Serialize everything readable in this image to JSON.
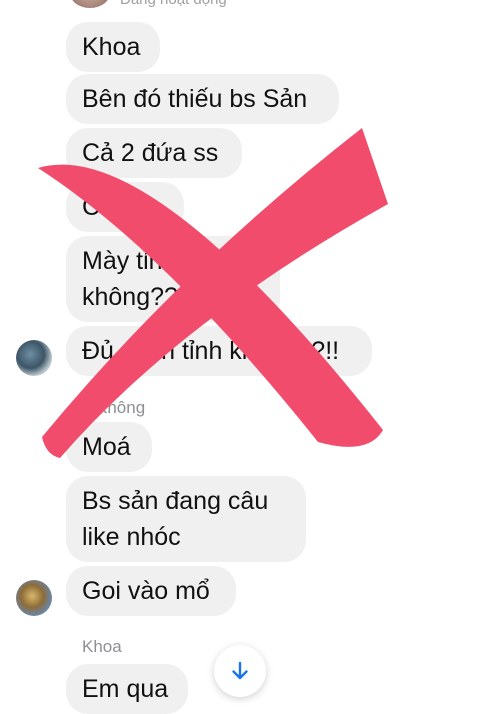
{
  "header": {
    "status": "Đang hoạt động"
  },
  "messages": [
    {
      "text": "Khoa"
    },
    {
      "text": "Bên đó thiếu bs Sản"
    },
    {
      "text": "Cả 2 đứa ss"
    },
    {
      "text": "Cả bs"
    },
    {
      "line1": "Mày tỉnh được",
      "line2": "không??????"
    },
    {
      "text": "Đủ minh tỉnh không??!!"
    },
    {
      "sender": "Không"
    },
    {
      "text": "Moá"
    },
    {
      "line1": "Bs sản đang câu",
      "line2": "like nhóc"
    },
    {
      "text": "Goi vào mổ"
    },
    {
      "sender": "Khoa"
    },
    {
      "text": "Em qua"
    }
  ],
  "overlay": {
    "color": "#f14c6c",
    "type": "cross-mark"
  },
  "scroll_button": {
    "icon": "arrow-down-icon",
    "color": "#1a73e8"
  }
}
